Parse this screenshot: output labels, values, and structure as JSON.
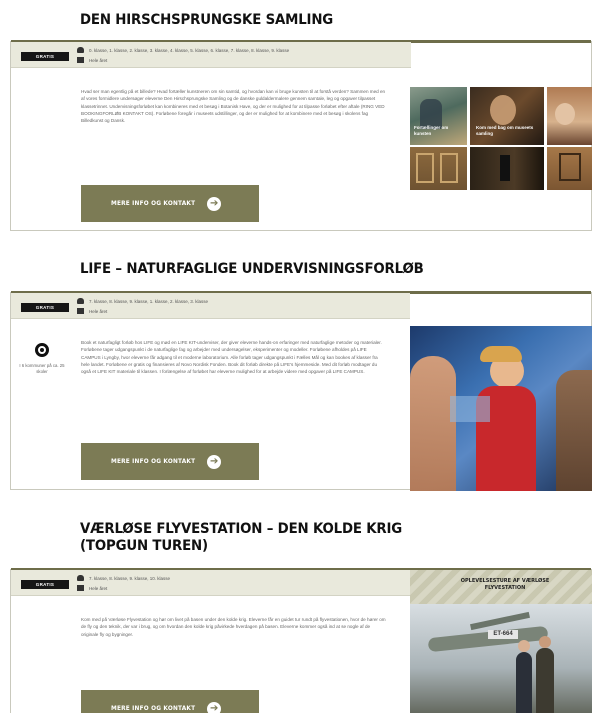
{
  "cards": [
    {
      "title": "DEN HIRSCHSPRUNGSKE SAMLING",
      "badge": "GRATIS",
      "meta_grades": "0. klasse, 1. klasse, 2. klasse, 3. klasse, 4. klasse, 5. klasse, 6. klasse, 7. klasse, 8. klasse, 9. klasse",
      "meta_time": "Hele året",
      "description": "Hvad ser man egentlig på et billede? Hvad fortæller kunstneren om sin samtid, og hvordan kan vi bruge kunsten til at forstå verden? Sammen med en af vores formidlere undersøger eleverne Den Hirschsprungske Samling og de danske guldaldermalere gennem samtale, leg og opgaver tilpasset klassetrinnet. Undervisningsforløbet kan kombineres med et besøg i Botanisk Have, og der er mulighed for at tilpasse forløbet efter aftale (RING VED BOOKINGFORLØB KONTAKT OS). Forløbene foregår i museets udstillinger, og der er mulighed for at kombinere med et besøg i skolens fag Billedkunst og Dansk.",
      "button": "MERE INFO OG KONTAKT",
      "tiles": [
        {
          "label": "Fortællinger om kunsten"
        },
        {
          "label": "Kom med bag om museets samling"
        },
        {
          "label": ""
        }
      ]
    },
    {
      "title": "LIFE – NATURFAGLIGE UNDERVISNINGSFORLØB",
      "badge": "GRATIS",
      "meta_grades": "7. klasse, 8. klasse, 9. klasse, 1. klasse, 2. klasse, 3. klasse",
      "meta_time": "Hele året",
      "side_text": "I 6 kommuner på ca. 25 skoler",
      "description": "Book et naturfagligt forløb hos LIFE og mød en LIFE KIT-underviser, der giver eleverne hands-on erfaringer med naturfaglige metoder og materialer. Forløbene tager udgangspunkt i de naturfaglige fag og arbejder med undersøgelser, eksperimenter og modeller. Forløbene afholdes på LIFE CAMPUS i Lyngby, hvor eleverne får adgang til et moderne laboratorium. Alle forløb tager udgangspunkt i Fælles Mål og kan bookes af klasser fra hele landet. Forløbene er gratis og finansieres af Novo Nordisk Fonden. Book dit forløb direkte på LIFE's hjemmeside. Med dit forløb modtager du også et LIFE KIT materiale til klassen. I forlængelse af forløbet har eleverne mulighed for at arbejde videre med opgaver på LIFE CAMPUS.",
      "button": "MERE INFO OG KONTAKT"
    },
    {
      "title_line1": "VÆRLØSE FLYVESTATION – DEN KOLDE KRIG",
      "title_line2": "(TOPGUN TUREN)",
      "badge": "GRATIS",
      "meta_grades": "7. klasse, 8. klasse, 9. klasse, 10. klasse",
      "meta_time": "Hele året",
      "promo": "OPLEVELSESTURE AF VÆRLØSE FLYVESTATION",
      "description": "Kom med på Værløse Flyvestation og hør om livet på basen under den kolde krig. Eleverne får en guidet tur rundt på flyvestationen, hvor de hører om de fly og den teknik, der var i brug, og om hvordan den kolde krig påvirkede hverdagen på basen. Eleverne kommer også ind at se nogle af de originale fly og bygninger.",
      "button": "MERE INFO OG KONTAKT"
    }
  ],
  "colors": {
    "accent": "#7c7b55",
    "meta_bg": "#e9e9dc",
    "badge_bg": "#161616"
  },
  "icons": [
    "people-icon",
    "calendar-icon",
    "arrow-right-icon",
    "target-icon"
  ]
}
